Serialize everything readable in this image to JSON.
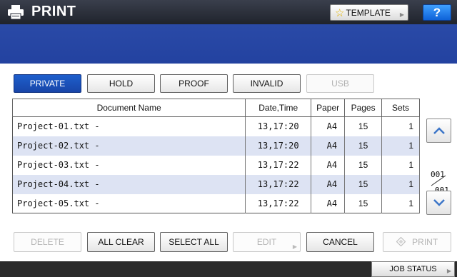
{
  "header": {
    "title": "PRINT",
    "template_label": "TEMPLATE",
    "help_label": "?"
  },
  "tabs": [
    {
      "label": "PRIVATE",
      "state": "active"
    },
    {
      "label": "HOLD",
      "state": "normal"
    },
    {
      "label": "PROOF",
      "state": "normal"
    },
    {
      "label": "INVALID",
      "state": "normal"
    },
    {
      "label": "USB",
      "state": "disabled"
    }
  ],
  "table": {
    "columns": [
      "Document Name",
      "Date,Time",
      "Paper",
      "Pages",
      "Sets"
    ],
    "rows": [
      {
        "name": "Project-01.txt -",
        "datetime": "13,17:20",
        "paper": "A4",
        "pages": "15",
        "sets": "1"
      },
      {
        "name": "Project-02.txt -",
        "datetime": "13,17:20",
        "paper": "A4",
        "pages": "15",
        "sets": "1"
      },
      {
        "name": "Project-03.txt -",
        "datetime": "13,17:22",
        "paper": "A4",
        "pages": "15",
        "sets": "1"
      },
      {
        "name": "Project-04.txt -",
        "datetime": "13,17:22",
        "paper": "A4",
        "pages": "15",
        "sets": "1"
      },
      {
        "name": "Project-05.txt -",
        "datetime": "13,17:22",
        "paper": "A4",
        "pages": "15",
        "sets": "1"
      }
    ]
  },
  "pager": {
    "current": "001",
    "total": "001"
  },
  "actions": {
    "delete": "DELETE",
    "all_clear": "ALL CLEAR",
    "select_all": "SELECT ALL",
    "edit": "EDIT",
    "cancel": "CANCEL",
    "print": "PRINT"
  },
  "footer": {
    "job_status": "JOB STATUS"
  },
  "colors": {
    "title_bar": "#2a2e38",
    "header_band": "#2645a4",
    "active_tab": "#1a52ba",
    "row_alt": "#dde3f3",
    "help_button": "#1e7ff0"
  }
}
